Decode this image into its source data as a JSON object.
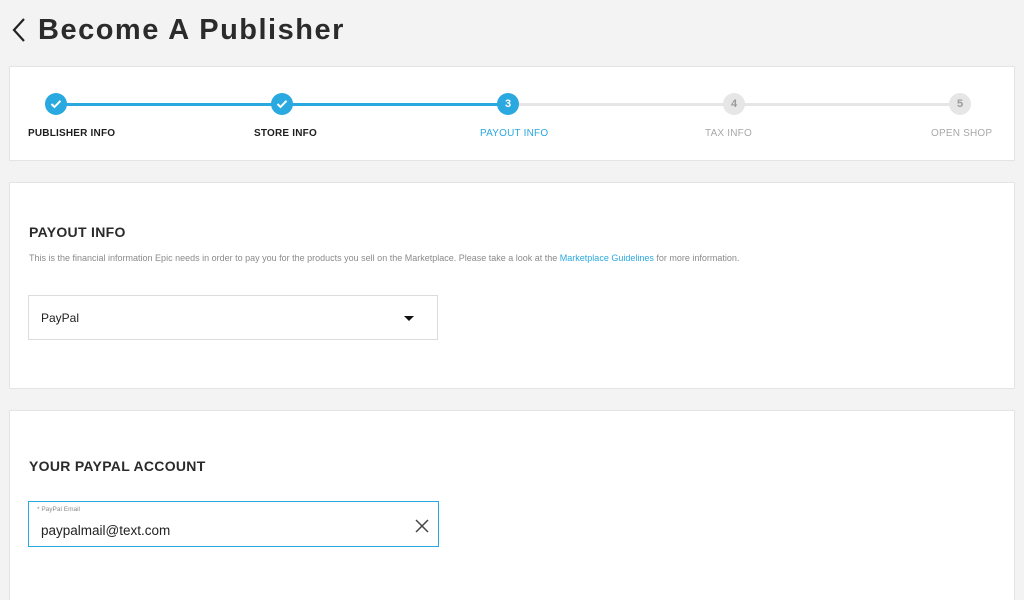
{
  "header": {
    "title": "Become A Publisher",
    "back_icon": "chevron-left-icon"
  },
  "stepper": {
    "colors": {
      "complete": "#2aa8e0",
      "pending": "#e6e6e6"
    },
    "steps": [
      {
        "number": "1",
        "label": "PUBLISHER INFO",
        "state": "complete",
        "icon": "check-icon"
      },
      {
        "number": "2",
        "label": "STORE INFO",
        "state": "complete",
        "icon": "check-icon"
      },
      {
        "number": "3",
        "label": "PAYOUT INFO",
        "state": "active"
      },
      {
        "number": "4",
        "label": "TAX INFO",
        "state": "pending"
      },
      {
        "number": "5",
        "label": "OPEN SHOP",
        "state": "pending"
      }
    ]
  },
  "payout": {
    "title": "PAYOUT INFO",
    "description_before": "This is the financial information Epic needs in order to pay you for the products you sell on the Marketplace. Please take a look at the ",
    "link_text": "Marketplace Guidelines",
    "description_after": " for more information.",
    "method_selected": "PayPal",
    "caret_icon": "caret-down-icon"
  },
  "paypal": {
    "title": "YOUR PAYPAL ACCOUNT",
    "email_label": "* PayPal Email",
    "email_value": "paypalmail@text.com",
    "clear_icon": "close-icon"
  }
}
